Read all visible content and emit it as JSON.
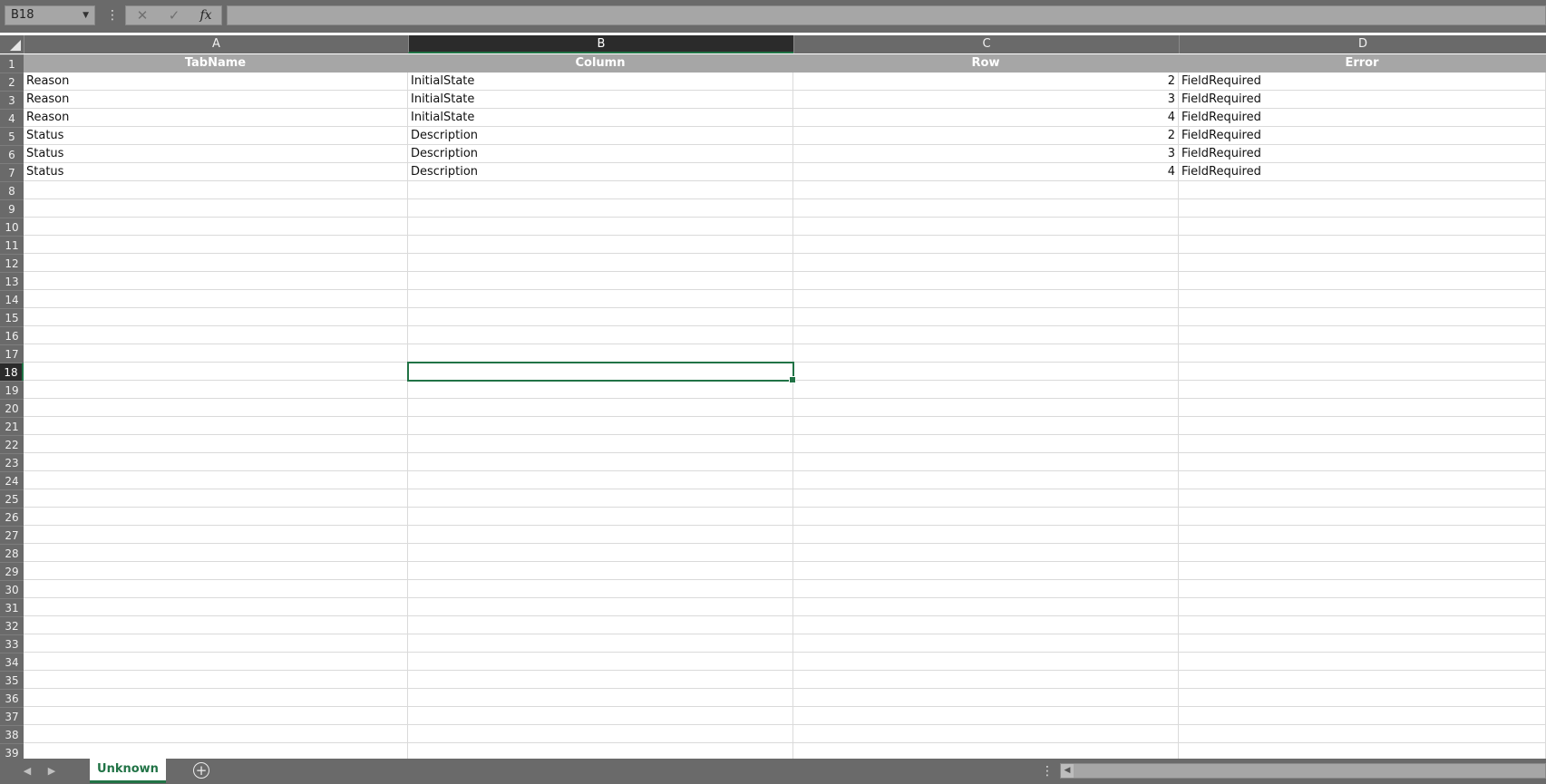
{
  "formula_bar": {
    "name_box": "B18",
    "cancel_icon": "✕",
    "enter_icon": "✓",
    "fx_label": "fx",
    "formula": ""
  },
  "columns": [
    {
      "letter": "A",
      "selected": false
    },
    {
      "letter": "B",
      "selected": true
    },
    {
      "letter": "C",
      "selected": false
    },
    {
      "letter": "D",
      "selected": false
    }
  ],
  "header_row": [
    "TabName",
    "Column",
    "Row",
    "Error"
  ],
  "data_rows": [
    [
      "Reason",
      "InitialState",
      "2",
      "FieldRequired"
    ],
    [
      "Reason",
      "InitialState",
      "3",
      "FieldRequired"
    ],
    [
      "Reason",
      "InitialState",
      "4",
      "FieldRequired"
    ],
    [
      "Status",
      "Description",
      "2",
      "FieldRequired"
    ],
    [
      "Status",
      "Description",
      "3",
      "FieldRequired"
    ],
    [
      "Status",
      "Description",
      "4",
      "FieldRequired"
    ]
  ],
  "row_numbers": [
    "1",
    "2",
    "3",
    "4",
    "5",
    "6",
    "7",
    "8",
    "9",
    "10",
    "11",
    "12",
    "13",
    "14",
    "15",
    "16",
    "17",
    "18",
    "19",
    "20",
    "21",
    "22",
    "23",
    "24",
    "25",
    "26",
    "27",
    "28",
    "29",
    "30",
    "31",
    "32",
    "33",
    "34",
    "35",
    "36",
    "37",
    "38",
    "39"
  ],
  "selected_row": "18",
  "sheet_tabs": [
    "Unknown"
  ],
  "colors": {
    "accent": "#217346",
    "chrome": "#6a6a6a",
    "header_fill": "#a6a6a6"
  }
}
